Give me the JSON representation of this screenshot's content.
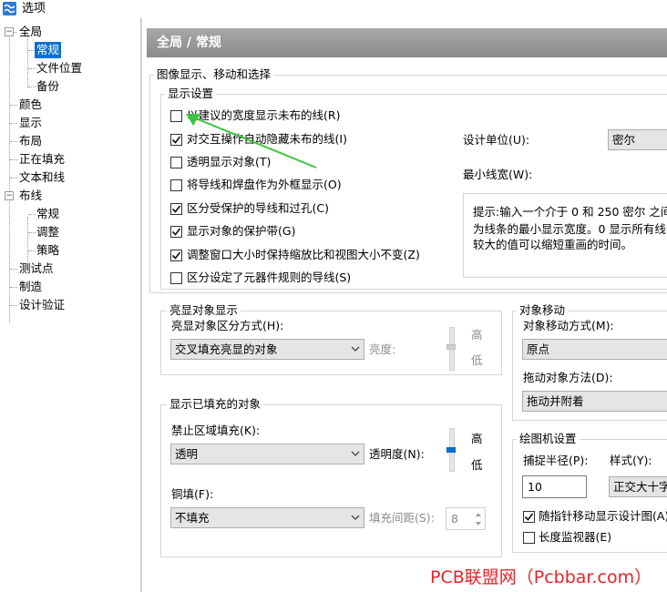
{
  "window": {
    "title": "选项"
  },
  "tree": {
    "items": [
      {
        "label": "全局",
        "expander": "−"
      },
      {
        "label": "常规"
      },
      {
        "label": "文件位置"
      },
      {
        "label": "备份"
      },
      {
        "label": "颜色"
      },
      {
        "label": "显示"
      },
      {
        "label": "布局"
      },
      {
        "label": "正在填充"
      },
      {
        "label": "文本和线"
      },
      {
        "label": "布线",
        "expander": "−"
      },
      {
        "label": "常规"
      },
      {
        "label": "调整"
      },
      {
        "label": "策略"
      },
      {
        "label": "测试点"
      },
      {
        "label": "制造"
      },
      {
        "label": "设计验证"
      }
    ]
  },
  "page": {
    "title": "全局 / 常规"
  },
  "image_display": {
    "title": "图像显示、移动和选择",
    "display_settings": {
      "title": "显示设置",
      "options": [
        {
          "label": "以建议的宽度显示未布的线(R)",
          "checked": false
        },
        {
          "label": "对交互操作自动隐藏未布的线(I)",
          "checked": true
        },
        {
          "label": "透明显示对象(T)",
          "checked": false
        },
        {
          "label": "将导线和焊盘作为外框显示(O)",
          "checked": false
        },
        {
          "label": "区分受保护的导线和过孔(C)",
          "checked": true
        },
        {
          "label": "显示对象的保护带(G)",
          "checked": true
        },
        {
          "label": "调整窗口大小时保持缩放比和视图大小不变(Z)",
          "checked": true
        },
        {
          "label": "区分设定了元器件规则的导线(S)",
          "checked": false
        }
      ],
      "design_unit_label": "设计单位(U):",
      "design_unit_value": "密尔",
      "min_line_width_label": "最小线宽(W):",
      "hint_lines": [
        "提示:输入一个介于 0 和 250 密尔 之间的",
        "为线条的最小显示宽度。0 显示所有线的",
        "较大的值可以缩短重画的时间。"
      ]
    }
  },
  "highlight": {
    "title": "亮显对象显示",
    "mode_label": "亮显对象区分方式(H):",
    "mode_value": "交叉填充亮显的对象",
    "brightness_label": "亮度:",
    "high": "高",
    "low": "低"
  },
  "filled": {
    "title": "显示已填充的对象",
    "area_fill_label": "禁止区域填充(K):",
    "area_fill_value": "透明",
    "transparency_label": "透明度(N):",
    "high": "高",
    "low": "低",
    "copper_label": "铜填(F):",
    "copper_value": "不填充",
    "fill_spacing_label": "填充间距(S):",
    "fill_spacing_value": "8"
  },
  "object_move": {
    "title": "对象移动",
    "method_label": "对象移动方式(M):",
    "method_value": "原点",
    "drag_label": "拖动对象方法(D):",
    "drag_value": "拖动并附着"
  },
  "plotter": {
    "title": "绘图机设置",
    "snap_radius_label": "捕捉半径(P):",
    "snap_radius_value": "10",
    "style_label": "样式(Y):",
    "style_value": "正交大十字",
    "pointer_move_label": "随指针移动显示设计图(A)",
    "pointer_move_checked": true,
    "length_monitor_label": "长度监视器(E)",
    "length_monitor_checked": false
  },
  "watermark": "PCB联盟网（Pcbbar.com）",
  "colors": {
    "accent": "#0b6fd3",
    "annotation_arrow": "#3cc43c",
    "watermark": "#e8232a",
    "header": "#979797"
  }
}
